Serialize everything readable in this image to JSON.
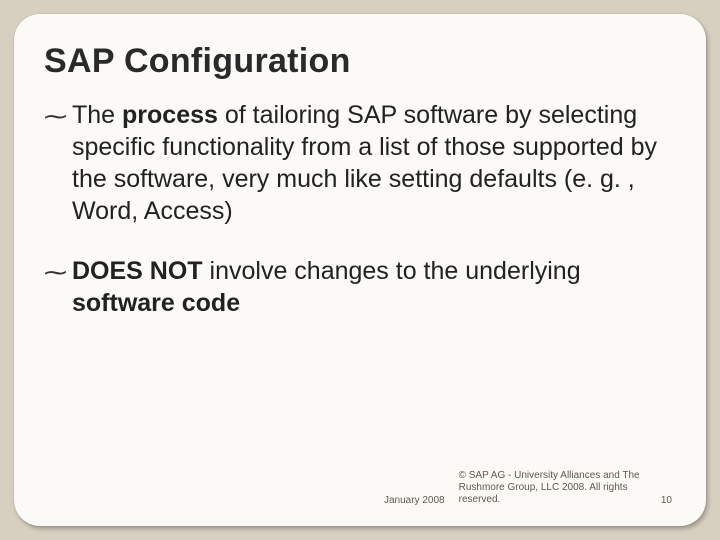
{
  "slide": {
    "title": "SAP Configuration",
    "bullets": [
      {
        "segments": [
          {
            "t": "The ",
            "b": false
          },
          {
            "t": "process",
            "b": true
          },
          {
            "t": " of tailoring SAP software by selecting specific functionality from a list of those supported by the software, very much like setting defaults (e. g. , Word, Access)",
            "b": false
          }
        ]
      },
      {
        "segments": [
          {
            "t": "DOES NOT",
            "b": true
          },
          {
            "t": " involve changes to the underlying ",
            "b": false
          },
          {
            "t": "software code",
            "b": true
          }
        ]
      }
    ],
    "footer": {
      "date": "January 2008",
      "copyright": "© SAP AG - University Alliances and The Rushmore Group, LLC 2008. All rights reserved.",
      "page": "10"
    }
  },
  "glyphs": {
    "bullet": "⁓"
  }
}
